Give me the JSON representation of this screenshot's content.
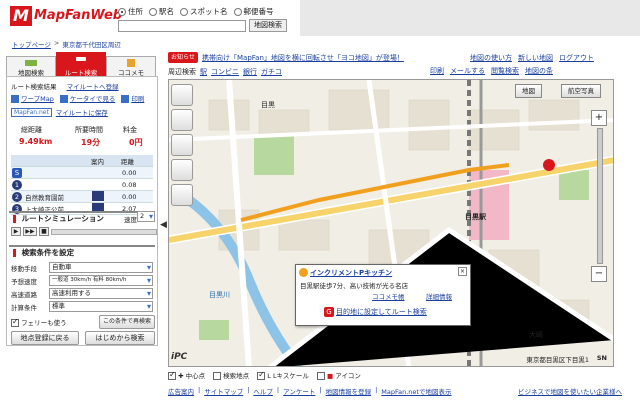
{
  "header": {
    "logo_text": "MapFanWeb",
    "radios": [
      {
        "label": "住所",
        "selected": true
      },
      {
        "label": "駅名",
        "selected": false
      },
      {
        "label": "スポット名",
        "selected": false
      },
      {
        "label": "郵便番号",
        "selected": false
      }
    ],
    "search_button": "地図検索"
  },
  "breadcrumb": [
    "トップページ",
    "東京都千代田区周辺"
  ],
  "left_tabs": [
    "地図検索",
    "ルート検索",
    "ココメモ"
  ],
  "route": {
    "header": "ルート検索結果",
    "my_route": "マイルートへ登録",
    "links": [
      "ワープMap",
      "ケータイで見る",
      "印刷"
    ],
    "save_my_route": "マイルートに保存",
    "mapfan_label": "MapFan.net",
    "summary_headers": [
      "総距離",
      "所要時間",
      "料金"
    ],
    "summary_values": [
      "9.49km",
      "19分",
      "0円"
    ],
    "table_cols": [
      "",
      "案内",
      "距離"
    ],
    "rows": [
      {
        "badge": "S",
        "text": "",
        "dist": "0.00"
      },
      {
        "badge": "1",
        "text": "",
        "dist": "0.08"
      },
      {
        "badge": "2",
        "text": "自然教育園前",
        "dist": "0.00"
      },
      {
        "badge": "3",
        "text": "上大崎正公前",
        "dist": "2.07"
      }
    ]
  },
  "simulation": {
    "title": "ルートシミュレーション",
    "speed_label": "速度",
    "speed_value": "2"
  },
  "conditions": {
    "title": "検索条件を設定",
    "fields": [
      {
        "label": "移動手段",
        "value": "自動車"
      },
      {
        "label": "予想速度",
        "value": "一般道 30km/h 有料 80km/h"
      },
      {
        "label": "高速道路",
        "value": "高速利用する"
      },
      {
        "label": "計算条件",
        "value": "標準"
      }
    ],
    "ferry_label": "フェリーも使う",
    "reroute_button": "この条件で再検索",
    "back_button": "地点登録に戻る",
    "restart_button": "はじめから検索"
  },
  "map": {
    "news_badge": "お知らせ",
    "news_text": "携帯向け「MapFan」地図を横に回転させ「ヨコ地図」が登場！",
    "top_links": [
      "地図の使い方",
      "新しい地図",
      "ログアウト"
    ],
    "toolbar_label": "周辺検索",
    "toolbar_items": [
      "駅",
      "コンビニ",
      "銀行",
      "ガチコ"
    ],
    "toolbar_right": [
      "印刷",
      "メールする",
      "閲覧検索",
      "地図の条"
    ],
    "view_buttons": [
      "地図",
      "航空写真"
    ],
    "popup": {
      "title": "インクリメントPキッチン",
      "desc": "目黒駅徒歩7分、高い技術が光る名店",
      "act1": "ココメモ帳",
      "act2": "詳細情報",
      "setgoal": "目的地に設定してルート検索"
    },
    "labels": [
      "目黒",
      "目黒駅",
      "目黒川",
      "大崎"
    ],
    "bottom": [
      {
        "label": "中心点",
        "checked": true
      },
      {
        "label": "検索地点",
        "checked": false
      },
      {
        "label": "Lキスケール",
        "checked": true
      },
      {
        "label": "アイコン",
        "checked": false
      }
    ],
    "address": "東京都目黒区下目黒1",
    "scale_label": "SN"
  },
  "footer": {
    "links": [
      "広告案内",
      "サイトマップ",
      "ヘルプ",
      "アンケート",
      "地図情報を登録",
      "MapFan.netで地図表示"
    ],
    "right": "ビジネスで地図を使いたい企業様へ"
  },
  "colors": {
    "brand": "#d8161b",
    "link": "#1a3fa0",
    "map_bg": "#f1eee5",
    "route": "#f0a01e"
  }
}
